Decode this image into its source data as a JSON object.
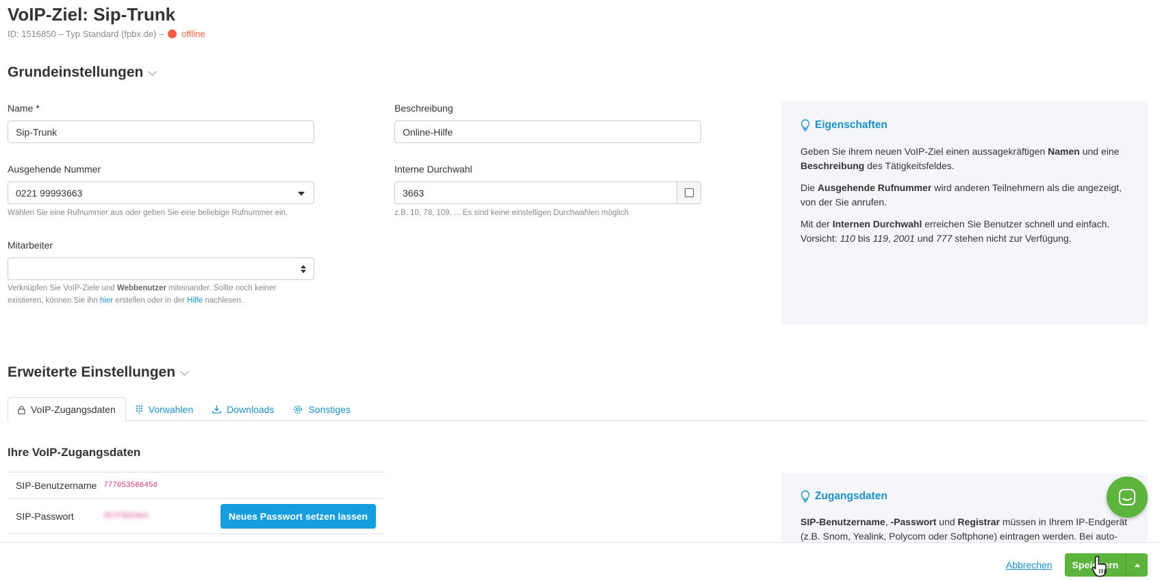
{
  "header": {
    "title": "VoIP-Ziel: Sip-Trunk",
    "meta": "ID: 1516850 – Typ Standard (fpbx.de) –",
    "status": "offline"
  },
  "basic": {
    "section_title": "Grundeinstellungen",
    "name_label": "Name *",
    "name_value": "Sip-Trunk",
    "description_label": "Beschreibung",
    "description_value": "Online-Hilfe",
    "outgoing_label": "Ausgehende Nummer",
    "outgoing_value": "0221 99993663",
    "outgoing_help": "Wählen Sie eine Rufnummer aus oder geben Sie eine beliebige Rufnummer ein.",
    "extension_label": "Interne Durchwahl",
    "extension_value": "3663",
    "extension_help": "z.B. 10, 78, 109, ... Es sind keine einstelligen Durchwahlen möglich",
    "employee_label": "Mitarbeiter",
    "employee_value": "",
    "employee_help_1": "Verknüpfen Sie VoIP-Ziele und",
    "employee_help_bold": "Webbenutzer",
    "employee_help_2": "miteinander. Sollte noch keiner existieren, können Sie ihn",
    "employee_help_link_here": "hier",
    "employee_help_3": "erstellen oder in der",
    "employee_help_link_help": "Hilfe",
    "employee_help_4": "nachlesen."
  },
  "properties_box": {
    "title": "Eigenschaften",
    "p1_a": "Geben Sie ihrem neuen VoIP-Ziel einen aussagekräftigen",
    "p1_b": "Namen",
    "p1_c": "und eine",
    "p1_d": "Beschreibung",
    "p1_e": "des Tätigkeitsfeldes.",
    "p2_a": "Die",
    "p2_b": "Ausgehende Rufnummer",
    "p2_c": "wird anderen Teilnehmern als die angezeigt, von der Sie anrufen.",
    "p3_a": "Mit der",
    "p3_b": "Internen Durchwahl",
    "p3_c": "erreichen Sie Benutzer schnell und einfach. Vorsicht:",
    "p3_d": "110",
    "p3_e": "bis",
    "p3_f": "119",
    "p3_g": ",",
    "p3_h": "2001",
    "p3_i": "und",
    "p3_j": "777",
    "p3_k": "stehen nicht zur Verfügung."
  },
  "advanced": {
    "section_title": "Erweiterte Einstellungen",
    "tabs": [
      {
        "label": "VoIP-Zugangsdaten",
        "icon": "lock-icon"
      },
      {
        "label": "Vorwahlen",
        "icon": "keypad-icon"
      },
      {
        "label": "Downloads",
        "icon": "download-icon"
      },
      {
        "label": "Sonstiges",
        "icon": "gear-icon"
      }
    ],
    "credentials_title": "Ihre VoIP-Zugangsdaten",
    "sip_user_label": "SIP-Benutzername",
    "sip_user_value": "777053566456",
    "sip_password_label": "SIP-Passwort",
    "sip_password_value": "3h7fGbk9e2",
    "new_password_button": "Neues Passwort setzen lassen"
  },
  "access_box": {
    "title": "Zugangsdaten",
    "text_a": "SIP-Benutzername",
    "text_b": ", ",
    "text_c": "-Passwort",
    "text_d": "und",
    "text_e": "Registrar",
    "text_f": "müssen in Ihrem IP-Endgerät (z.B. Snom, Yealink, Polycom oder Softphone) eintragen werden. Bei auto-"
  },
  "footer": {
    "cancel": "Abbrechen",
    "save": "Speichern"
  },
  "colors": {
    "accent": "#1a8fc9",
    "offline": "#f06040",
    "save_green": "#5cb43c",
    "button_blue": "#149ee0",
    "info_bg": "#f4f6f9"
  }
}
